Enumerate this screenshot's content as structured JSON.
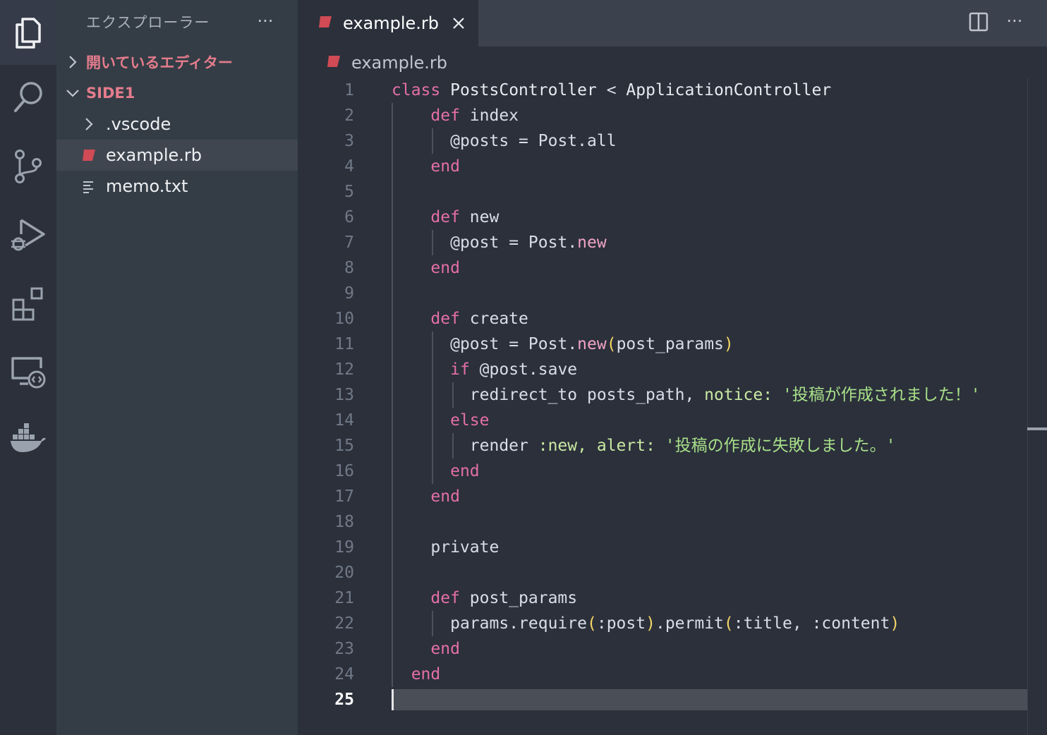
{
  "sidebar": {
    "title": "エクスプローラー",
    "more": "···",
    "open_editors": "開いているエディター",
    "workspace": "SIDE1",
    "items": [
      {
        "label": ".vscode",
        "kind": "folder"
      },
      {
        "label": "example.rb",
        "kind": "ruby"
      },
      {
        "label": "memo.txt",
        "kind": "text"
      }
    ]
  },
  "editor": {
    "tab_label": "example.rb",
    "breadcrumb": "example.rb",
    "more": "···",
    "current_line": 25,
    "line_numbers": [
      "1",
      "2",
      "3",
      "4",
      "5",
      "6",
      "7",
      "8",
      "9",
      "10",
      "11",
      "12",
      "13",
      "14",
      "15",
      "16",
      "17",
      "18",
      "19",
      "20",
      "21",
      "22",
      "23",
      "24",
      "25"
    ]
  },
  "colors": {
    "keyword": "#e46fa7",
    "string": "#a8e088",
    "paren": "#f2d565",
    "ruby_icon": "#d04b55",
    "section_label": "#e47c8c"
  },
  "icons": {
    "activity": [
      "explorer-icon",
      "search-icon",
      "source-control-icon",
      "run-debug-icon",
      "extensions-icon",
      "remote-explorer-icon",
      "docker-icon"
    ]
  },
  "code": {
    "l1": {
      "kw": "class",
      "name": "PostsController",
      "op": "<",
      "parent": "ApplicationController"
    },
    "l2": {
      "kw": "def",
      "name": "index"
    },
    "l3": {
      "ivar": "@posts",
      "eq": "=",
      "recv": "Post",
      "dot": ".",
      "meth": "all"
    },
    "l4": {
      "kw": "end"
    },
    "l6": {
      "kw": "def",
      "name": "new"
    },
    "l7": {
      "ivar": "@post",
      "eq": "=",
      "recv": "Post",
      "dot": ".",
      "meth": "new"
    },
    "l8": {
      "kw": "end"
    },
    "l10": {
      "kw": "def",
      "name": "create"
    },
    "l11": {
      "ivar": "@post",
      "eq": "=",
      "recv": "Post",
      "dot": ".",
      "meth": "new",
      "open": "(",
      "arg": "post_params",
      "close": ")"
    },
    "l12": {
      "kw": "if",
      "ivar": "@post",
      "dot": ".",
      "meth": "save"
    },
    "l13": {
      "meth": "redirect_to",
      "arg": "posts_path,",
      "key": "notice:",
      "str": "'投稿が作成されました！'"
    },
    "l14": {
      "kw": "else"
    },
    "l15": {
      "meth": "render",
      "sym": ":new,",
      "key": "alert:",
      "str": "'投稿の作成に失敗しました。'"
    },
    "l16": {
      "kw": "end"
    },
    "l17": {
      "kw": "end"
    },
    "l19": {
      "text": "private"
    },
    "l21": {
      "kw": "def",
      "name": "post_params"
    },
    "l22": {
      "recv": "params",
      "dot": ".",
      "meth": "require",
      "open": "(",
      "sym": ":post",
      "close": ")",
      "dot2": ".",
      "meth2": "permit",
      "open2": "(",
      "sym2": ":title,",
      "sym3": ":content",
      "close2": ")"
    },
    "l23": {
      "kw": "end"
    },
    "l24": {
      "kw": "end"
    }
  }
}
